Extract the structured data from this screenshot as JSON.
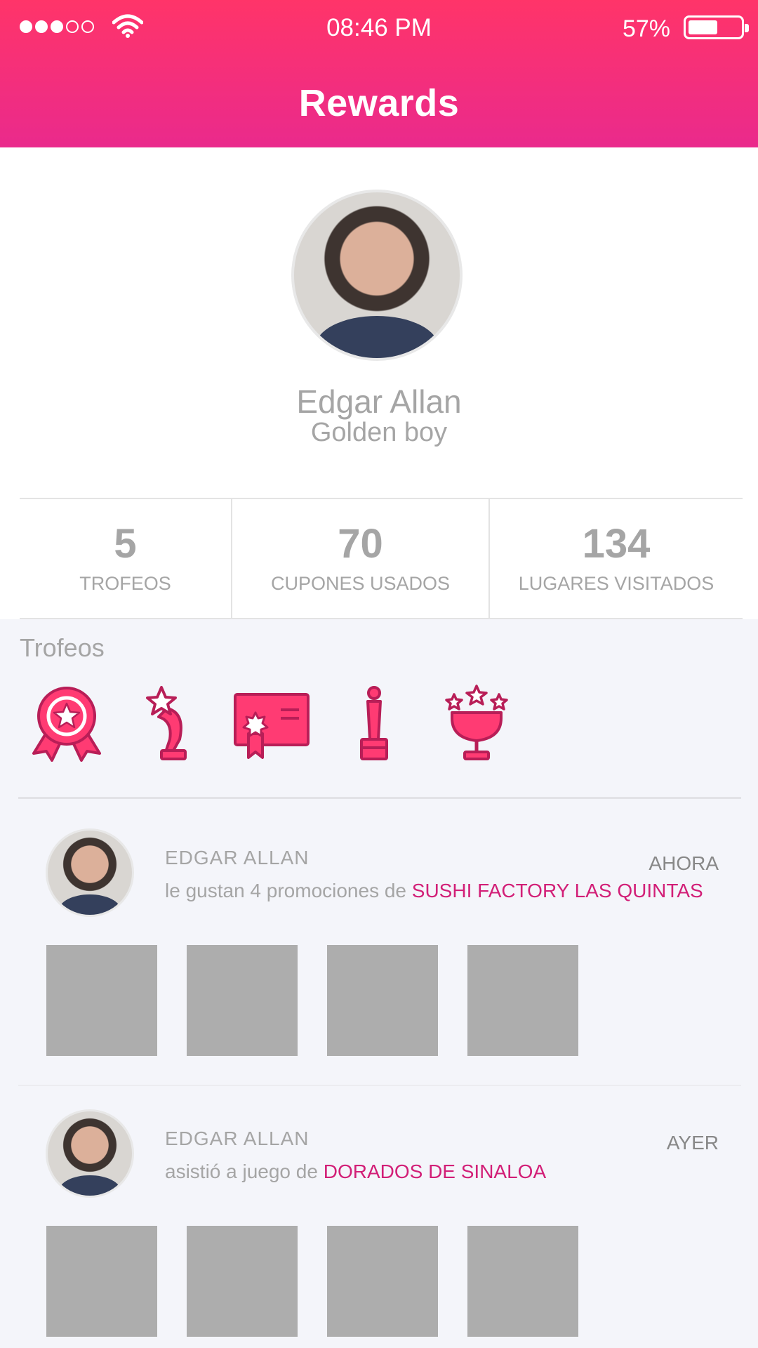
{
  "status": {
    "time": "08:46 PM",
    "battery": "57%",
    "battery_level": 0.57,
    "signal_bars_filled": 3,
    "signal_bars_total": 5
  },
  "header": {
    "title": "Rewards"
  },
  "profile": {
    "name": "Edgar Allan",
    "subtitle": "Golden boy"
  },
  "stats": [
    {
      "value": "5",
      "label": "TROFEOS"
    },
    {
      "value": "70",
      "label": "CUPONES USADOS"
    },
    {
      "value": "134",
      "label": "LUGARES VISITADOS"
    }
  ],
  "trophies": {
    "title": "Trofeos",
    "icons": [
      "award-ribbon-icon",
      "star-trophy-icon",
      "certificate-icon",
      "oscar-trophy-icon",
      "cup-stars-icon"
    ]
  },
  "feed": [
    {
      "user": "EDGAR ALLAN",
      "text": "le gustan 4 promociones de",
      "link": "SUSHI FACTORY LAS QUINTAS",
      "time": "AHORA"
    },
    {
      "user": "EDGAR ALLAN",
      "text": "asistió a juego de",
      "link": "DORADOS DE SINALOA",
      "time": "AYER"
    }
  ],
  "colors": {
    "header_gradient_top": "#ff3469",
    "header_gradient_bottom": "#ea2a8c",
    "accent": "#d21f77",
    "icon_fill": "#ff3b73",
    "icon_stroke": "#b81e57"
  }
}
